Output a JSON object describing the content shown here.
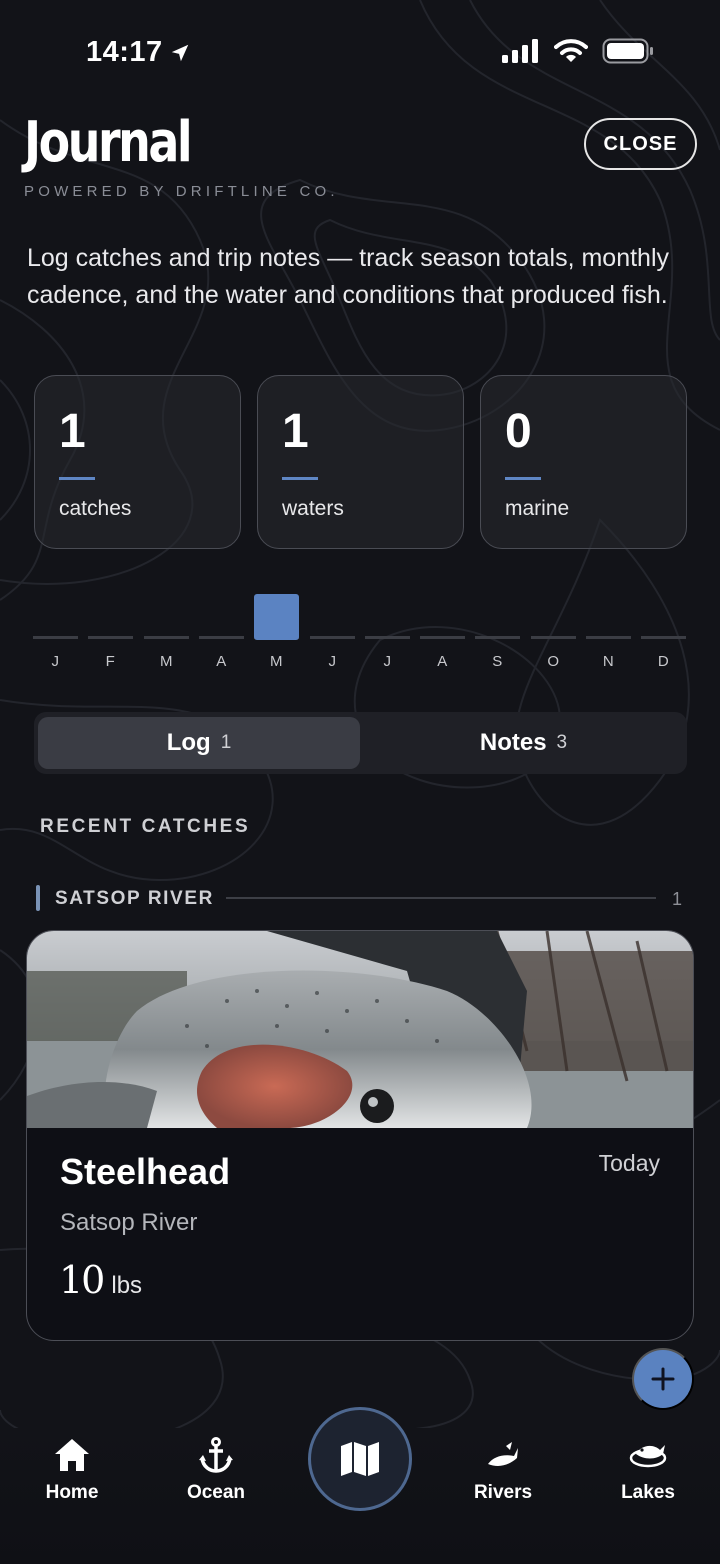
{
  "status_bar": {
    "time": "14:17"
  },
  "header": {
    "title": "Journal",
    "subtitle": "POWERED BY DRIFTLINE CO.",
    "close_label": "CLOSE"
  },
  "intro": "Log catches and trip notes — track season totals, monthly cadence, and the water and conditions that produced fish.",
  "stats": [
    {
      "value": "1",
      "label": "catches"
    },
    {
      "value": "1",
      "label": "waters"
    },
    {
      "value": "0",
      "label": "marine"
    }
  ],
  "months": {
    "labels": [
      "J",
      "F",
      "M",
      "A",
      "M",
      "J",
      "J",
      "A",
      "S",
      "O",
      "N",
      "D"
    ],
    "counts": [
      0,
      0,
      0,
      0,
      1,
      0,
      0,
      0,
      0,
      0,
      0,
      0
    ]
  },
  "tabs": {
    "log": {
      "label": "Log",
      "count": "1"
    },
    "notes": {
      "label": "Notes",
      "count": "3"
    }
  },
  "section_title": "RECENT CATCHES",
  "group": {
    "name": "SATSOP RIVER",
    "count": "1"
  },
  "catch": {
    "species": "Steelhead",
    "date": "Today",
    "water": "Satsop River",
    "weight_value": "10",
    "weight_unit": "lbs"
  },
  "nav": {
    "home": "Home",
    "ocean": "Ocean",
    "rivers": "Rivers",
    "lakes": "Lakes"
  },
  "colors": {
    "accent": "#5b83c2",
    "background": "#121318"
  }
}
